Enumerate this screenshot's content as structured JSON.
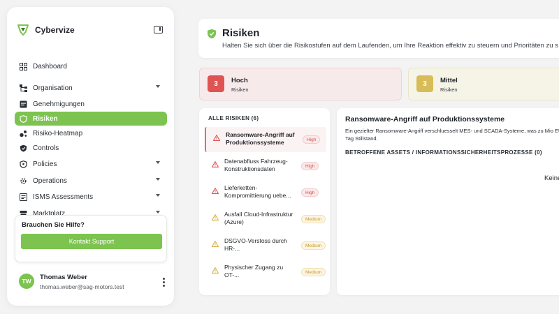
{
  "app": {
    "name": "Cybervize"
  },
  "sidebar": {
    "items": [
      {
        "label": "Dashboard",
        "icon": "grid-icon",
        "expandable": false
      },
      {
        "label": "Organisation",
        "icon": "org-icon",
        "expandable": true
      },
      {
        "label": "Genehmigungen",
        "icon": "approval-icon",
        "expandable": false
      },
      {
        "label": "Risiken",
        "icon": "shield-icon",
        "expandable": false,
        "active": true
      },
      {
        "label": "Risiko-Heatmap",
        "icon": "heatmap-icon",
        "expandable": false
      },
      {
        "label": "Controls",
        "icon": "controls-icon",
        "expandable": false
      },
      {
        "label": "Policies",
        "icon": "policy-icon",
        "expandable": true
      },
      {
        "label": "Operations",
        "icon": "operations-icon",
        "expandable": true
      },
      {
        "label": "ISMS Assessments",
        "icon": "assessment-icon",
        "expandable": true
      },
      {
        "label": "Marktplatz",
        "icon": "store-icon",
        "expandable": true
      }
    ],
    "help": {
      "title": "Brauchen Sie Hilfe?",
      "button": "Kontakt Support"
    },
    "user": {
      "initials": "TW",
      "name": "Thomas Weber",
      "email": "thomas.weber@sag-motors.test"
    }
  },
  "header": {
    "title": "Risiken",
    "subtitle": "Halten Sie sich über die Risikostufen auf dem Laufenden, um Ihre Reaktion effektiv zu steuern und Prioritäten zu s"
  },
  "stats": [
    {
      "count": "3",
      "label": "Hoch",
      "sub": "Risiken"
    },
    {
      "count": "3",
      "label": "Mittel",
      "sub": "Risiken"
    }
  ],
  "risk_list": {
    "heading": "ALLE RISIKEN (6)",
    "items": [
      {
        "title": "Ransomware-Angriff auf Produktionssysteme",
        "level": "High"
      },
      {
        "title": "Datenabfluss Fahrzeug-Konstruktionsdaten",
        "level": "High"
      },
      {
        "title": "Lieferketten-Kompromittierung uebe...",
        "level": "High"
      },
      {
        "title": "Ausfall Cloud-Infrastruktur (Azure)",
        "level": "Medium"
      },
      {
        "title": "DSGVO-Verstoss durch HR-...",
        "level": "Medium"
      },
      {
        "title": "Physischer Zugang zu OT-...",
        "level": "Medium"
      }
    ]
  },
  "detail": {
    "title": "Ransomware-Angriff auf Produktionssysteme",
    "description": "Ein gezielter Ransomware-Angriff verschluesselt MES- und SCADA-Systeme, was zu Mio EUR pro Tag Stillstand.",
    "assets_heading": "BETROFFENE ASSETS / INFORMATIONSSICHERHEITSPROZESSE (0)",
    "empty_text": "Keine"
  },
  "colors": {
    "accent": "#7cc34f",
    "high": "#e05353",
    "medium": "#d8bc58"
  }
}
